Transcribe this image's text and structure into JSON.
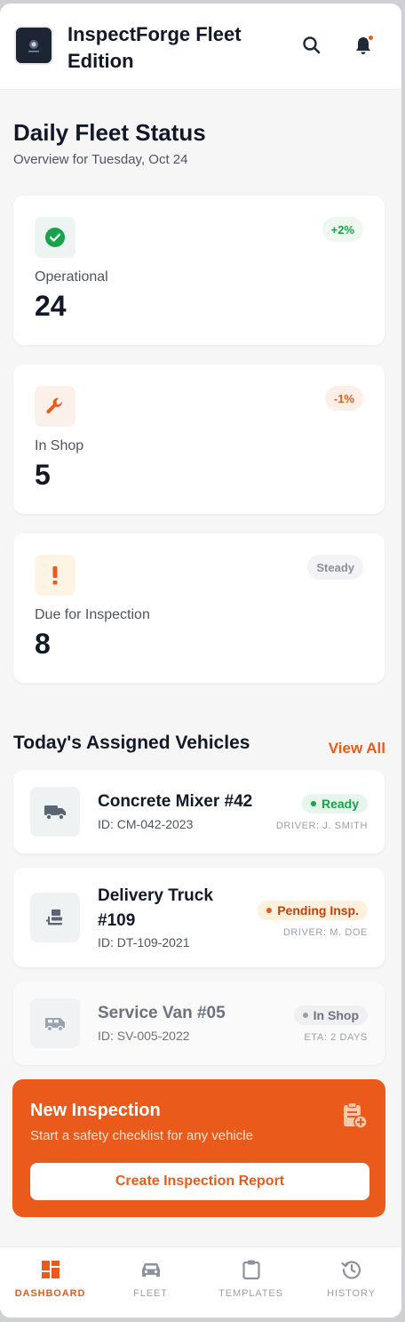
{
  "header": {
    "title": "InspectForge Fleet Edition",
    "logo_icon": "company-logo",
    "search_icon": "search-icon",
    "bell_icon": "bell-icon"
  },
  "status": {
    "title": "Daily Fleet Status",
    "subtitle": "Overview for Tuesday, Oct 24",
    "cards": [
      {
        "label": "Operational",
        "value": "24",
        "trend": "+2%",
        "icon": "check-circle-icon",
        "color": "#16a34a"
      },
      {
        "label": "In Shop",
        "value": "5",
        "trend": "-1%",
        "icon": "wrench-icon",
        "color": "#ea5b1b"
      },
      {
        "label": "Due for Inspection",
        "value": "8",
        "trend": "Steady",
        "icon": "exclamation-icon",
        "color": "#f59e0b"
      }
    ]
  },
  "vehicles": {
    "title": "Today's Assigned Vehicles",
    "view_all": "View All",
    "items": [
      {
        "name": "Concrete Mixer #42",
        "id": "ID: CM-042-2023",
        "status": "Ready",
        "meta": "DRIVER: J. SMITH",
        "icon": "truck-icon"
      },
      {
        "name": "Delivery Truck #109",
        "id": "ID: DT-109-2021",
        "status": "Pending Insp.",
        "meta": "DRIVER: M. DOE",
        "icon": "forklift-icon"
      },
      {
        "name": "Service Van #05",
        "id": "ID: SV-005-2022",
        "status": "In Shop",
        "meta": "ETA: 2 DAYS",
        "icon": "van-icon"
      }
    ]
  },
  "cta": {
    "title": "New Inspection",
    "subtitle": "Start a safety checklist for any vehicle",
    "button": "Create Inspection Report",
    "icon": "clipboard-add-icon"
  },
  "nav": {
    "items": [
      {
        "label": "DASHBOARD",
        "icon": "dashboard-icon",
        "active": true
      },
      {
        "label": "FLEET",
        "icon": "car-icon",
        "active": false
      },
      {
        "label": "TEMPLATES",
        "icon": "clipboard-icon",
        "active": false
      },
      {
        "label": "HISTORY",
        "icon": "history-icon",
        "active": false
      }
    ]
  },
  "colors": {
    "accent": "#ea5b1b",
    "success": "#16a34a",
    "warning": "#f59e0b"
  }
}
